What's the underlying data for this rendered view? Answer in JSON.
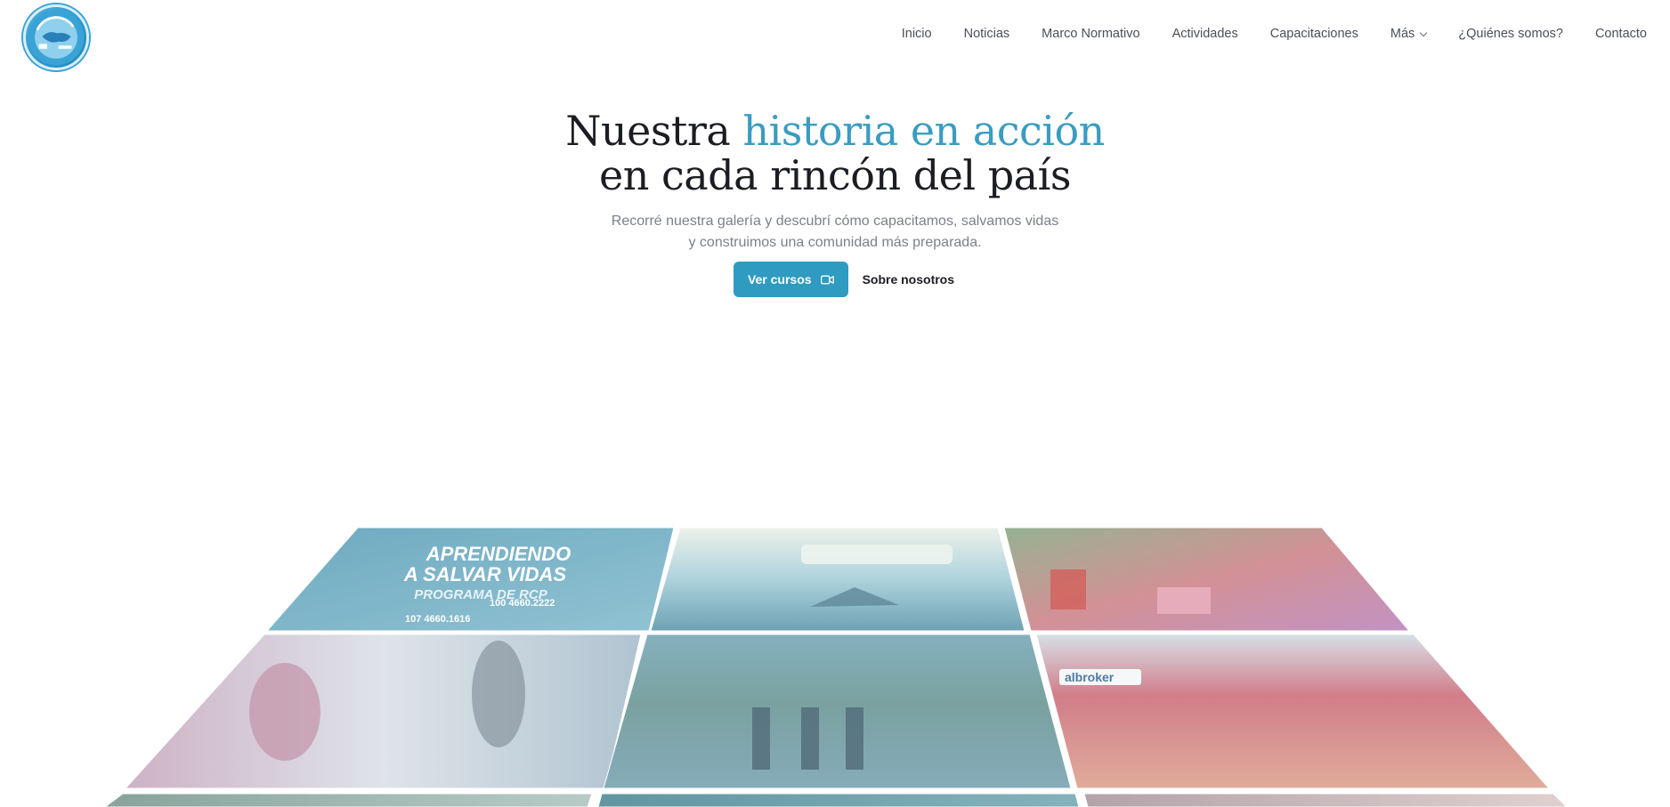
{
  "header": {
    "logo_name": "argentina-badge-logo",
    "nav": [
      {
        "label": "Inicio"
      },
      {
        "label": "Noticias"
      },
      {
        "label": "Marco Normativo"
      },
      {
        "label": "Actividades"
      },
      {
        "label": "Capacitaciones"
      },
      {
        "label": "Más",
        "has_dropdown": true
      },
      {
        "label": "¿Quiénes somos?"
      },
      {
        "label": "Contacto"
      }
    ]
  },
  "hero": {
    "title_part1": "Nuestra",
    "title_accent": "historia en acción",
    "title_line2": "en cada rincón del país",
    "subtitle_line1": "Recorré nuestra galería y descubrí cómo capacitamos, salvamos vidas",
    "subtitle_line2": "y construimos una comunidad más preparada.",
    "primary_button": "Ver cursos",
    "primary_button_icon": "video-camera-icon",
    "secondary_button": "Sobre nosotros"
  },
  "gallery": {
    "tiles": [
      {
        "name": "gallery-photo-rcp-poster",
        "poster_title": "APRENDIENDO A SALVAR VIDAS",
        "poster_subtitle": "PROGRAMA DE RCP",
        "color": "#5fa6bf"
      },
      {
        "name": "gallery-photo-demo-stage",
        "color": "#7ab7c9"
      },
      {
        "name": "gallery-photo-outdoor-class",
        "color": "#b57aa0"
      },
      {
        "name": "gallery-photo-training-room",
        "color": "#a6b9c7"
      },
      {
        "name": "gallery-photo-police-field",
        "color": "#6f9fab"
      },
      {
        "name": "gallery-photo-group-gym",
        "color": "#c77a86"
      },
      {
        "name": "gallery-photo-row3-left",
        "color": "#7d9f9a"
      },
      {
        "name": "gallery-photo-row3-center",
        "color": "#4d8996"
      },
      {
        "name": "gallery-photo-row3-right",
        "color": "#b8a3a6"
      }
    ]
  },
  "colors": {
    "accent": "#3a9cc1",
    "button": "#2f9bc0",
    "text_dark": "#1b1d22",
    "text_muted": "#7b8088"
  }
}
